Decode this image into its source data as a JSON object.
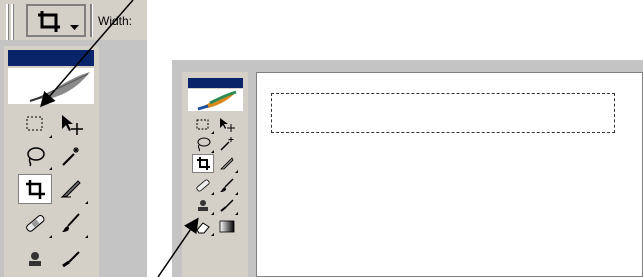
{
  "options_bar": {
    "width_label": "Width:"
  },
  "left_toolbox": {
    "tools": [
      {
        "name": "marquee-tool-icon",
        "selected": false
      },
      {
        "name": "move-tool-icon",
        "selected": false
      },
      {
        "name": "lasso-tool-icon",
        "selected": false
      },
      {
        "name": "magic-wand-tool-icon",
        "selected": false
      },
      {
        "name": "crop-tool-icon",
        "selected": true
      },
      {
        "name": "slice-tool-icon",
        "selected": false
      },
      {
        "name": "healing-brush-tool-icon",
        "selected": false
      },
      {
        "name": "brush-tool-icon",
        "selected": false
      }
    ]
  },
  "right_toolbox": {
    "tools": [
      {
        "name": "marquee-tool-icon",
        "selected": false
      },
      {
        "name": "move-tool-icon",
        "selected": false
      },
      {
        "name": "lasso-tool-icon",
        "selected": false
      },
      {
        "name": "magic-wand-tool-icon",
        "selected": false
      },
      {
        "name": "crop-tool-icon",
        "selected": true
      },
      {
        "name": "slice-tool-icon",
        "selected": false
      },
      {
        "name": "healing-brush-tool-icon",
        "selected": false
      },
      {
        "name": "brush-tool-icon",
        "selected": false
      },
      {
        "name": "clone-stamp-tool-icon",
        "selected": false
      },
      {
        "name": "history-brush-tool-icon",
        "selected": false
      },
      {
        "name": "eraser-tool-icon",
        "selected": false
      },
      {
        "name": "gradient-tool-icon",
        "selected": false
      }
    ]
  },
  "colors": {
    "toolbar_gray": "#d4d0c8",
    "panel_gray": "#c4c4c4",
    "title_blue": "#0a246a",
    "selection_dash": "#333333",
    "arrow": "#000000"
  }
}
